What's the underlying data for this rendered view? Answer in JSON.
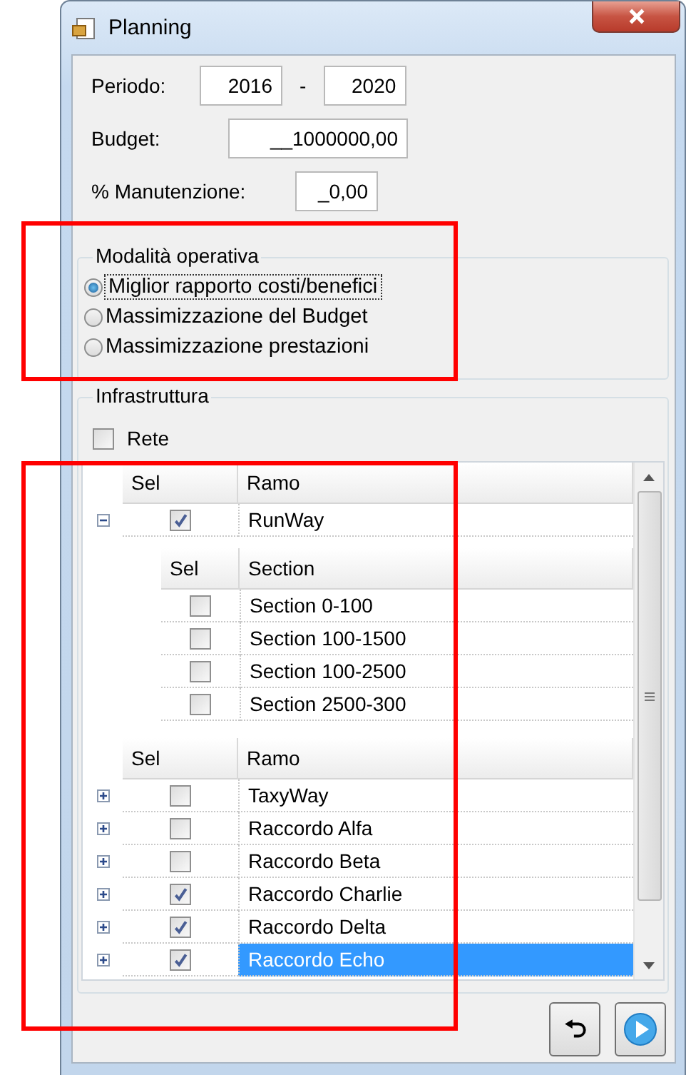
{
  "window": {
    "title": "Planning"
  },
  "periodo": {
    "label": "Periodo:",
    "from": "2016",
    "separator": "-",
    "to": "2020"
  },
  "budget": {
    "label": "Budget:",
    "value": "__1000000,00"
  },
  "manutenzione": {
    "label": "% Manutenzione:",
    "value": "_0,00"
  },
  "mode_group": {
    "title": "Modalità operativa",
    "highlighted": true,
    "options": [
      {
        "label": "Miglior rapporto costi/benefici",
        "selected": true
      },
      {
        "label": "Massimizzazione del Budget",
        "selected": false
      },
      {
        "label": "Massimizzazione prestazioni",
        "selected": false
      }
    ]
  },
  "infra_group": {
    "title": "Infrastruttura",
    "rete": {
      "label": "Rete",
      "checked": false
    }
  },
  "grid": {
    "highlighted": true,
    "blocks": [
      {
        "kind": "header",
        "columns": [
          "Sel",
          "Ramo"
        ]
      },
      {
        "kind": "row",
        "name": "RunWay",
        "checked": true,
        "expanded": true,
        "selected": false,
        "detail": {
          "columns": [
            "Sel",
            "Section"
          ],
          "rows": [
            {
              "name": "Section 0-100",
              "checked": false
            },
            {
              "name": "Section 100-1500",
              "checked": false
            },
            {
              "name": "Section 100-2500",
              "checked": false
            },
            {
              "name": "Section 2500-300",
              "checked": false
            }
          ]
        }
      },
      {
        "kind": "header",
        "columns": [
          "Sel",
          "Ramo"
        ]
      },
      {
        "kind": "row",
        "name": "TaxyWay",
        "checked": false,
        "expanded": false,
        "selected": false
      },
      {
        "kind": "row",
        "name": "Raccordo Alfa",
        "checked": false,
        "expanded": false,
        "selected": false
      },
      {
        "kind": "row",
        "name": "Raccordo Beta",
        "checked": false,
        "expanded": false,
        "selected": false
      },
      {
        "kind": "row",
        "name": "Raccordo Charlie",
        "checked": true,
        "expanded": false,
        "selected": false
      },
      {
        "kind": "row",
        "name": "Raccordo Delta",
        "checked": true,
        "expanded": false,
        "selected": false
      },
      {
        "kind": "row",
        "name": "Raccordo Echo",
        "checked": true,
        "expanded": false,
        "selected": true
      }
    ]
  }
}
